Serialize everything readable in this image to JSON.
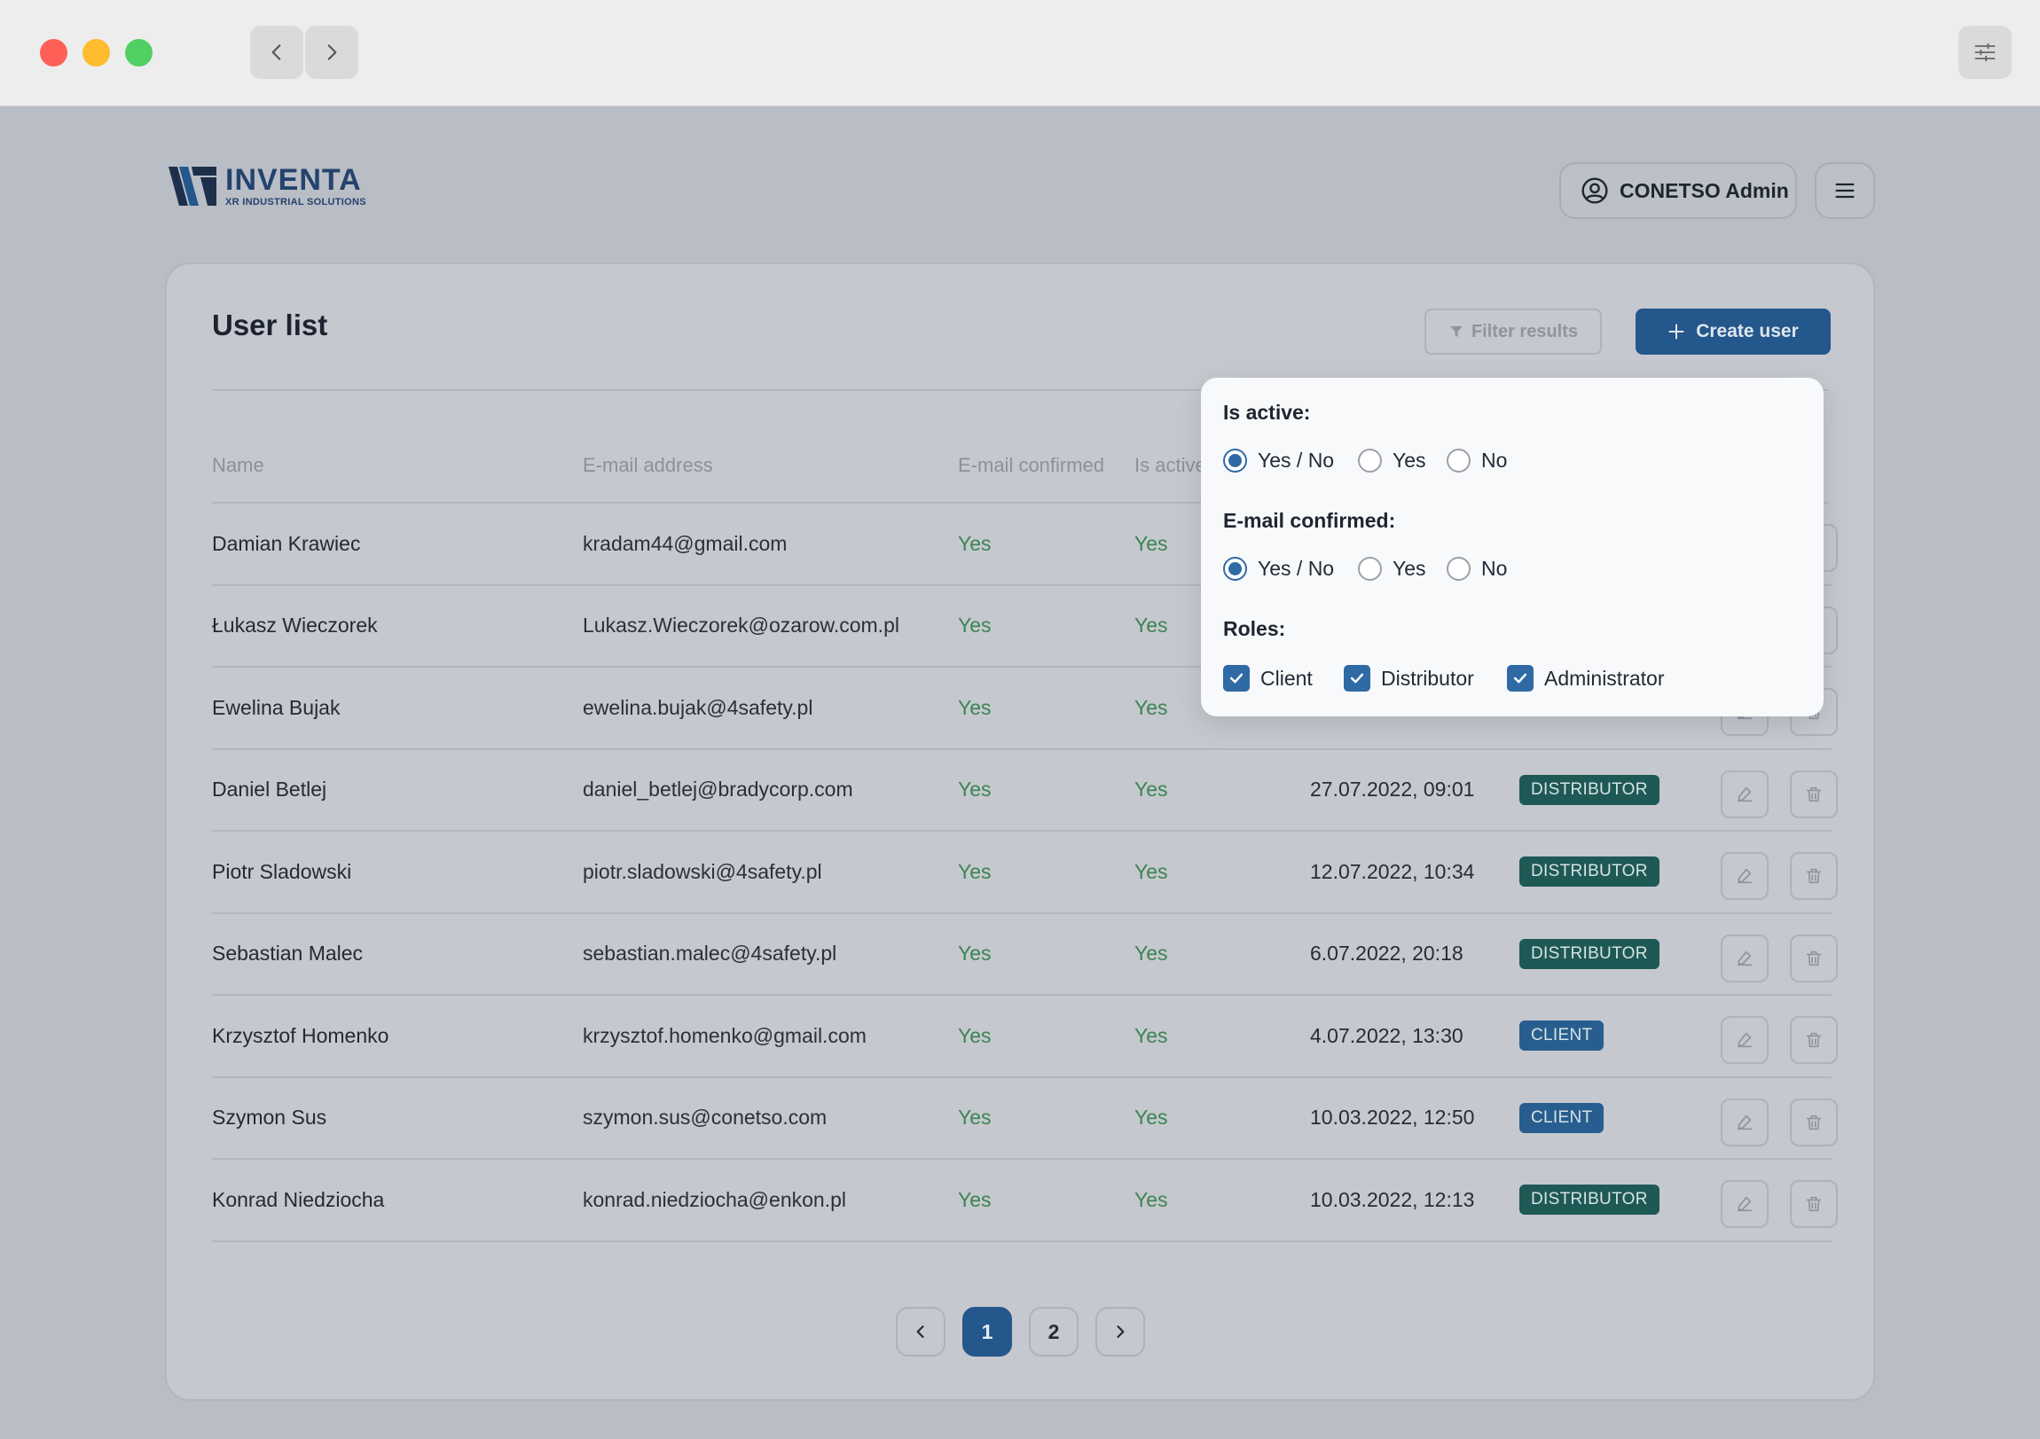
{
  "header": {
    "logo_title": "INVENTA",
    "logo_subtitle": "XR INDUSTRIAL SOLUTIONS",
    "user_label": "CONETSO Admin"
  },
  "card": {
    "title": "User list",
    "filter_label": "Filter results",
    "create_label": "Create user"
  },
  "table": {
    "columns": [
      "Name",
      "E-mail address",
      "E-mail confirmed",
      "Is active"
    ],
    "rows": [
      {
        "name": "Damian Krawiec",
        "email": "kradam44@gmail.com",
        "confirmed": "Yes",
        "active": "Yes",
        "date": "",
        "role": ""
      },
      {
        "name": "Łukasz Wieczorek",
        "email": "Lukasz.Wieczorek@ozarow.com.pl",
        "confirmed": "Yes",
        "active": "Yes",
        "date": "",
        "role": ""
      },
      {
        "name": "Ewelina Bujak",
        "email": "ewelina.bujak@4safety.pl",
        "confirmed": "Yes",
        "active": "Yes",
        "date": "",
        "role": ""
      },
      {
        "name": "Daniel Betlej",
        "email": "daniel_betlej@bradycorp.com",
        "confirmed": "Yes",
        "active": "Yes",
        "date": "27.07.2022, 09:01",
        "role": "DISTRIBUTOR"
      },
      {
        "name": "Piotr Sladowski",
        "email": "piotr.sladowski@4safety.pl",
        "confirmed": "Yes",
        "active": "Yes",
        "date": "12.07.2022, 10:34",
        "role": "DISTRIBUTOR"
      },
      {
        "name": "Sebastian Malec",
        "email": "sebastian.malec@4safety.pl",
        "confirmed": "Yes",
        "active": "Yes",
        "date": "6.07.2022, 20:18",
        "role": "DISTRIBUTOR"
      },
      {
        "name": "Krzysztof Homenko",
        "email": "krzysztof.homenko@gmail.com",
        "confirmed": "Yes",
        "active": "Yes",
        "date": "4.07.2022, 13:30",
        "role": "CLIENT"
      },
      {
        "name": "Szymon Sus",
        "email": "szymon.sus@conetso.com",
        "confirmed": "Yes",
        "active": "Yes",
        "date": "10.03.2022, 12:50",
        "role": "CLIENT"
      },
      {
        "name": "Konrad Niedziocha",
        "email": "konrad.niedziocha@enkon.pl",
        "confirmed": "Yes",
        "active": "Yes",
        "date": "10.03.2022, 12:13",
        "role": "DISTRIBUTOR"
      }
    ]
  },
  "pagination": {
    "pages": [
      "1",
      "2"
    ],
    "current": "1"
  },
  "filter_popup": {
    "is_active_label": "Is active:",
    "is_active_options": [
      "Yes / No",
      "Yes",
      "No"
    ],
    "is_active_selected": "Yes / No",
    "email_confirmed_label": "E-mail confirmed:",
    "email_confirmed_options": [
      "Yes / No",
      "Yes",
      "No"
    ],
    "email_confirmed_selected": "Yes / No",
    "roles_label": "Roles:",
    "roles": [
      {
        "label": "Client",
        "checked": true
      },
      {
        "label": "Distributor",
        "checked": true
      },
      {
        "label": "Administrator",
        "checked": true
      }
    ]
  },
  "colors": {
    "accent": "#24578b",
    "success_text": "#3b8553",
    "distributor_badge": "#1e5956",
    "client_badge": "#285e8f"
  },
  "icons": {
    "nav_back": "chevron-left-icon",
    "nav_forward": "chevron-right-icon",
    "settings": "sliders-icon",
    "user": "user-circle-icon",
    "menu": "hamburger-icon",
    "filter": "funnel-icon",
    "create": "plus-icon",
    "edit": "edit-icon",
    "delete": "trash-icon"
  }
}
